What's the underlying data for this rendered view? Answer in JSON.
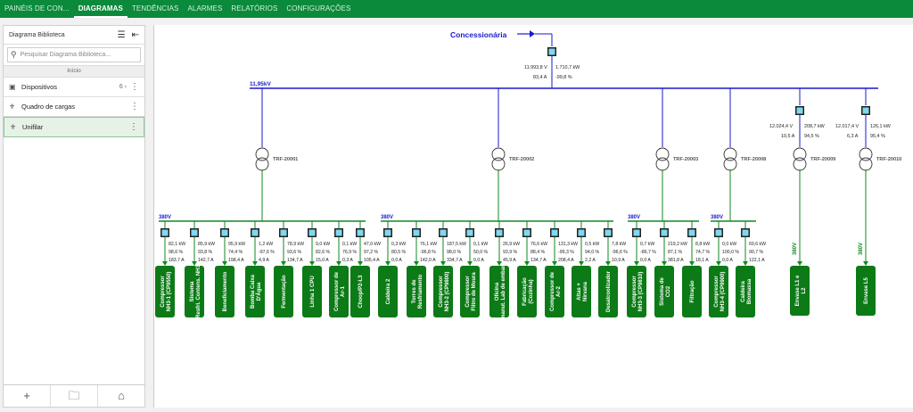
{
  "topnav": {
    "tabs": [
      {
        "label": "PAINÉIS DE CON...",
        "active": false
      },
      {
        "label": "DIAGRAMAS",
        "active": true
      },
      {
        "label": "TENDÊNCIAS",
        "active": false
      },
      {
        "label": "ALARMES",
        "active": false
      },
      {
        "label": "RELATÓRIOS",
        "active": false
      },
      {
        "label": "CONFIGURAÇÕES",
        "active": false
      }
    ],
    "color": "#0b8a3c"
  },
  "sidebar": {
    "title": "Diagrama Biblioteca",
    "search_placeholder": "Pesquisar Diagrama Biblioteca...",
    "breadcrumb": "Início",
    "items": [
      {
        "label": "Dispositivos",
        "count": "6",
        "icon": "device-icon",
        "selected": false
      },
      {
        "label": "Quadro de cargas",
        "count": "",
        "icon": "hierarchy-icon",
        "selected": false
      },
      {
        "label": "Unifilar",
        "count": "",
        "icon": "hierarchy-icon",
        "selected": true
      }
    ],
    "footer_icons": [
      "add-icon",
      "add-folder-icon",
      "home-icon"
    ]
  },
  "diagram": {
    "colors": {
      "bus": "#1a1acc",
      "green": "#0e8a1f",
      "meter": "#7fd8f0",
      "load": "#0c7a16"
    },
    "source": {
      "label": "Concessionária"
    },
    "main_meter": {
      "v": "11.993,8 V",
      "kw": "1.710,7 kW",
      "a": "83,4 A",
      "pf": "-99,8 %"
    },
    "hv_bus_label": "11,95kV",
    "transformers": [
      {
        "label": "TRF-20001"
      },
      {
        "label": "TRF-20002"
      },
      {
        "label": "TRF-20003"
      },
      {
        "label": "TRF-20008"
      },
      {
        "label": "TRF-20009",
        "meter": {
          "v": "12.024,4 V",
          "kw": "208,7 kW",
          "a": "10,5 A",
          "pf": "94,5 %"
        },
        "bus_label": "380V",
        "load": "Envase L1 e L2"
      },
      {
        "label": "TRF-20010",
        "meter": {
          "v": "12.017,4 V",
          "kw": "126,1 kW",
          "a": "6,3 A",
          "pf": "95,4 %"
        },
        "bus_label": "380V",
        "load": "Envase L5"
      }
    ],
    "lv_buses": [
      {
        "label": "380V"
      },
      {
        "label": "380V"
      },
      {
        "label": "380V"
      },
      {
        "label": "380V"
      }
    ],
    "feeders": [
      {
        "kw": "82,1 kW",
        "pf": "98,6 %",
        "a": "183,7 A",
        "name": "Compressor NH3-1 (CP9550)"
      },
      {
        "kw": "85,9 kW",
        "pf": "93,8 %",
        "a": "142,7 A",
        "name": "Sistema Resfri. Contens. NH3"
      },
      {
        "kw": "95,9 kW",
        "pf": "74,4 %",
        "a": "198,4 A",
        "name": "Beneficiamento"
      },
      {
        "kw": "1,2 kW",
        "pf": "-97,6 %",
        "a": "4,9 A",
        "name": "Bomba Caixa D'Água"
      },
      {
        "kw": "78,9 kW",
        "pf": "93,6 %",
        "a": "134,7 A",
        "name": "Fermentação"
      },
      {
        "kw": "9,0 kW",
        "pf": "82,6 %",
        "a": "15,0 A",
        "name": "Linha 1 CPU"
      },
      {
        "kw": "0,1 kW",
        "pf": "76,9 %",
        "a": "0,3 A",
        "name": "Compressor de Ar-1"
      },
      {
        "kw": "47,0 kW",
        "pf": "97,2 %",
        "a": "105,4 A",
        "name": "Choop/P2-L3"
      },
      {
        "kw": "0,3 kW",
        "pf": "80,5 %",
        "a": "0,0 A",
        "name": "Caldeira 2"
      },
      {
        "kw": "76,1 kW",
        "pf": "-96,8 %",
        "a": "142,0 A",
        "name": "Torres de Resfriamento"
      },
      {
        "kw": "187,5 kW",
        "pf": "98,0 %",
        "a": "334,7 A",
        "name": "Compressor NH3-2 (CP9800)"
      },
      {
        "kw": "0,1 kW",
        "pf": "50,0 %",
        "a": "0,0 A",
        "name": "Compressor Filtro de Moura"
      },
      {
        "kw": "26,9 kW",
        "pf": "93,9 %",
        "a": "45,9 A",
        "name": "Oficina manut. Lab de embar."
      },
      {
        "kw": "76,6 kW",
        "pf": "88,4 %",
        "a": "134,7 A",
        "name": "Fabricação (Cozinha)"
      },
      {
        "kw": "131,3 kW",
        "pf": "-99,3 %",
        "a": "208,4 A",
        "name": "Compressor de Ar-2"
      },
      {
        "kw": "0,5 kW",
        "pf": "94,0 %",
        "a": "2,2 A",
        "name": "Altas + Nirvana"
      },
      {
        "kw": "7,8 kW",
        "pf": "-96,6 %",
        "a": "10,9 A",
        "name": "Desalcoolizador"
      },
      {
        "kw": "0,7 kW",
        "pf": "-86,7 %",
        "a": "0,0 A",
        "name": "Compressor NH3-3 (CP9810)"
      },
      {
        "kw": "219,2 kW",
        "pf": "87,1 %",
        "a": "381,8 A",
        "name": "Sistema de CO2"
      },
      {
        "kw": "8,8 kW",
        "pf": "74,7 %",
        "a": "18,1 A",
        "name": "Filtração"
      },
      {
        "kw": "0,0 kW",
        "pf": "100,0 %",
        "a": "0,0 A",
        "name": "Compressor NH3-4 (CP9900)"
      },
      {
        "kw": "69,6 kW",
        "pf": "90,7 %",
        "a": "122,1 A",
        "name": "Caldeira Biomassa"
      }
    ]
  }
}
